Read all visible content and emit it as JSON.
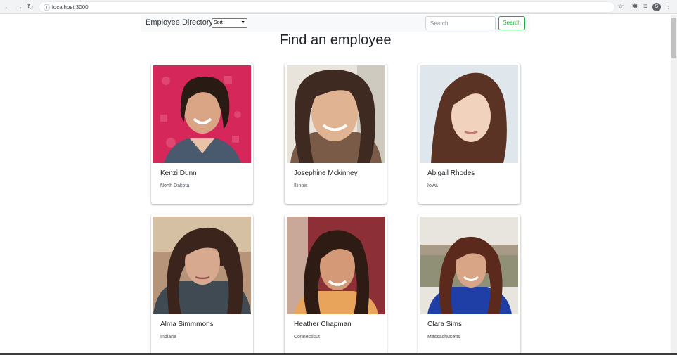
{
  "browser": {
    "url": "localhost:3000",
    "avatar_letter": "S"
  },
  "navbar": {
    "brand": "Employee Directory",
    "sort_selected": "Sort",
    "search_placeholder": "Search",
    "search_button": "Search"
  },
  "main": {
    "title": "Find an employee"
  },
  "employees": [
    {
      "name": "Kenzi Dunn",
      "state": "North Dakota"
    },
    {
      "name": "Josephine Mckinney",
      "state": "Illinois"
    },
    {
      "name": "Abigail Rhodes",
      "state": "Iowa"
    },
    {
      "name": "Alma Simmmons",
      "state": "Indiana"
    },
    {
      "name": "Heather Chapman",
      "state": "Connecticut"
    },
    {
      "name": "Clara Sims",
      "state": "Massachusetts"
    }
  ],
  "colors": {
    "accent_green": "#28a745",
    "navbar_bg": "#f8f9fa"
  }
}
